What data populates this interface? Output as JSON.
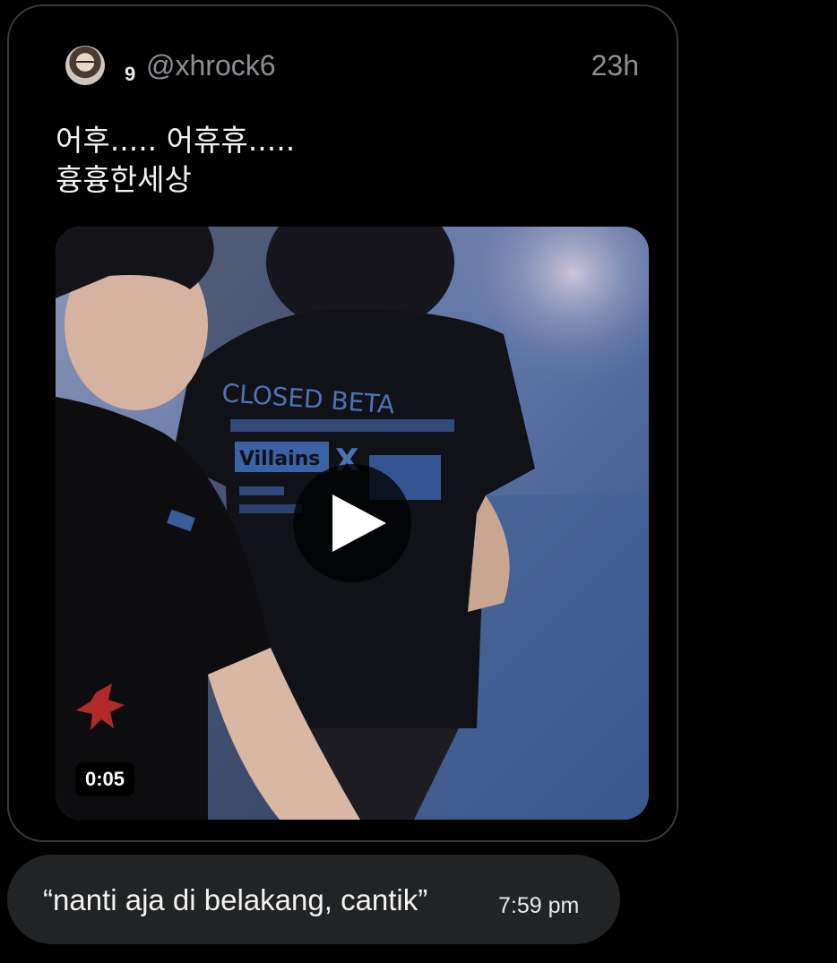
{
  "quoted_tweet": {
    "display_name": "9",
    "handle": "@xhrock6",
    "timestamp": "23h",
    "text_lines": [
      "어후..... 어휴휴.....",
      "흉흉한세상"
    ],
    "media": {
      "type": "video",
      "duration": "0:05",
      "shirt_text_1": "CLOSED BETA",
      "shirt_text_2": "Villains",
      "shirt_text_3": "X"
    }
  },
  "message": {
    "text": "“nanti aja di belakang, cantik”",
    "time": "7:59 pm"
  },
  "colors": {
    "background": "#000000",
    "card_border": "#38393c",
    "bubble": "#212325",
    "muted_text": "#8b8f94"
  },
  "icons": {
    "avatar": "profile-avatar",
    "play": "play-icon"
  }
}
